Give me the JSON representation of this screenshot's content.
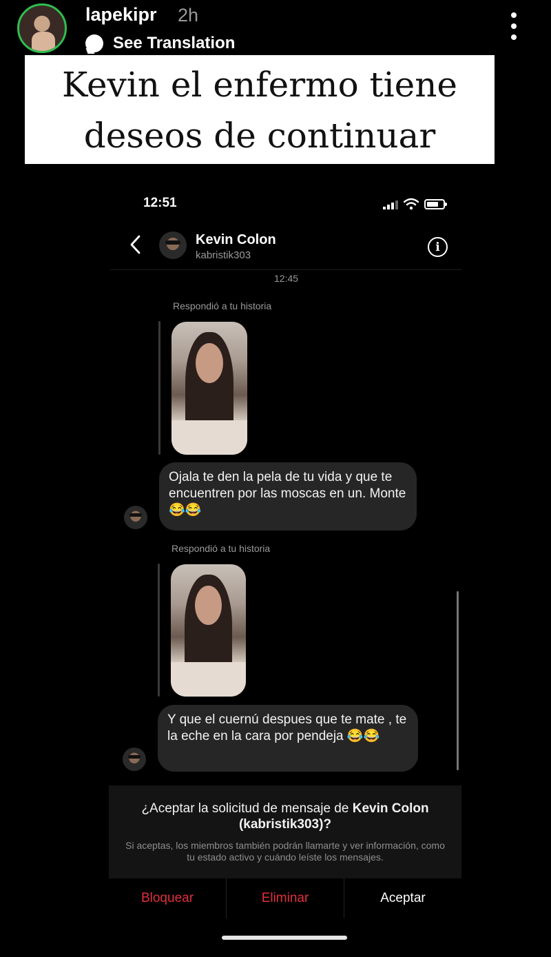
{
  "story": {
    "username": "lapekipr",
    "time_ago": "2h",
    "translation_label": "See Translation",
    "caption": "Kevin el enfermo tiene deseos de continuar"
  },
  "phone": {
    "status_time": "12:51",
    "contact": {
      "name": "Kevin Colon",
      "handle": "kabristik303"
    },
    "chat_time": "12:45",
    "messages": [
      {
        "reply_label": "Respondió a tu historia",
        "text": "Ojala te den la pela de tu vida y que te encuentren por las moscas en un. Monte 😂😂"
      },
      {
        "reply_label": "Respondió a tu historia",
        "text": "Y que el cuernú despues que te mate , te la eche en la cara por pendeja 😂😂"
      }
    ],
    "request": {
      "title_prefix": "¿Aceptar la solicitud de mensaje de ",
      "title_name": "Kevin Colon",
      "title_suffix": "(kabristik303)?",
      "note": "Si aceptas, los miembros también podrán llamarte y ver información, como tu estado activo y cuándo leíste los mensajes."
    },
    "actions": {
      "block": "Bloquear",
      "delete": "Eliminar",
      "accept": "Aceptar"
    }
  },
  "colors": {
    "danger": "#e0303d",
    "bubble": "#262626",
    "ring": "#2fbf4f"
  }
}
